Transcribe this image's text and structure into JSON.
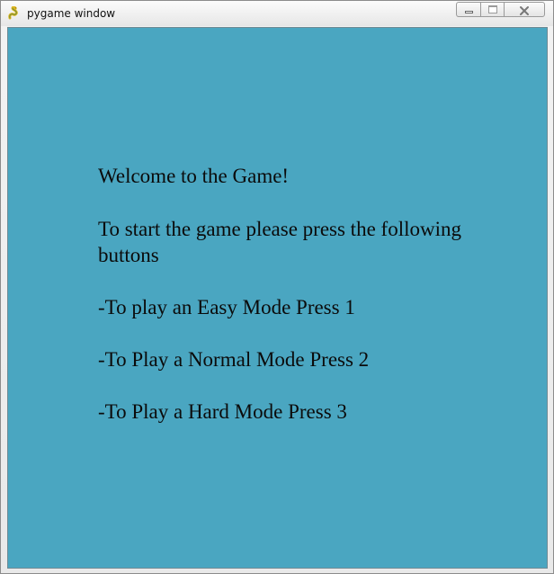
{
  "window": {
    "title": "pygame window",
    "icon": "pygame-snake-icon",
    "controls": {
      "minimize": "minimize-icon",
      "maximize": "maximize-icon",
      "close": "close-icon"
    }
  },
  "game": {
    "background_color": "#4aa6c1",
    "text_color": "#0b0b0b",
    "welcome": "Welcome to the Game!",
    "instructions_line1": "To start the game please press the following",
    "instructions_line2": "buttons",
    "easy_option": "-To play an Easy Mode Press 1",
    "normal_option": "-To Play a Normal Mode Press 2",
    "hard_option": "-To Play a Hard Mode Press 3"
  }
}
